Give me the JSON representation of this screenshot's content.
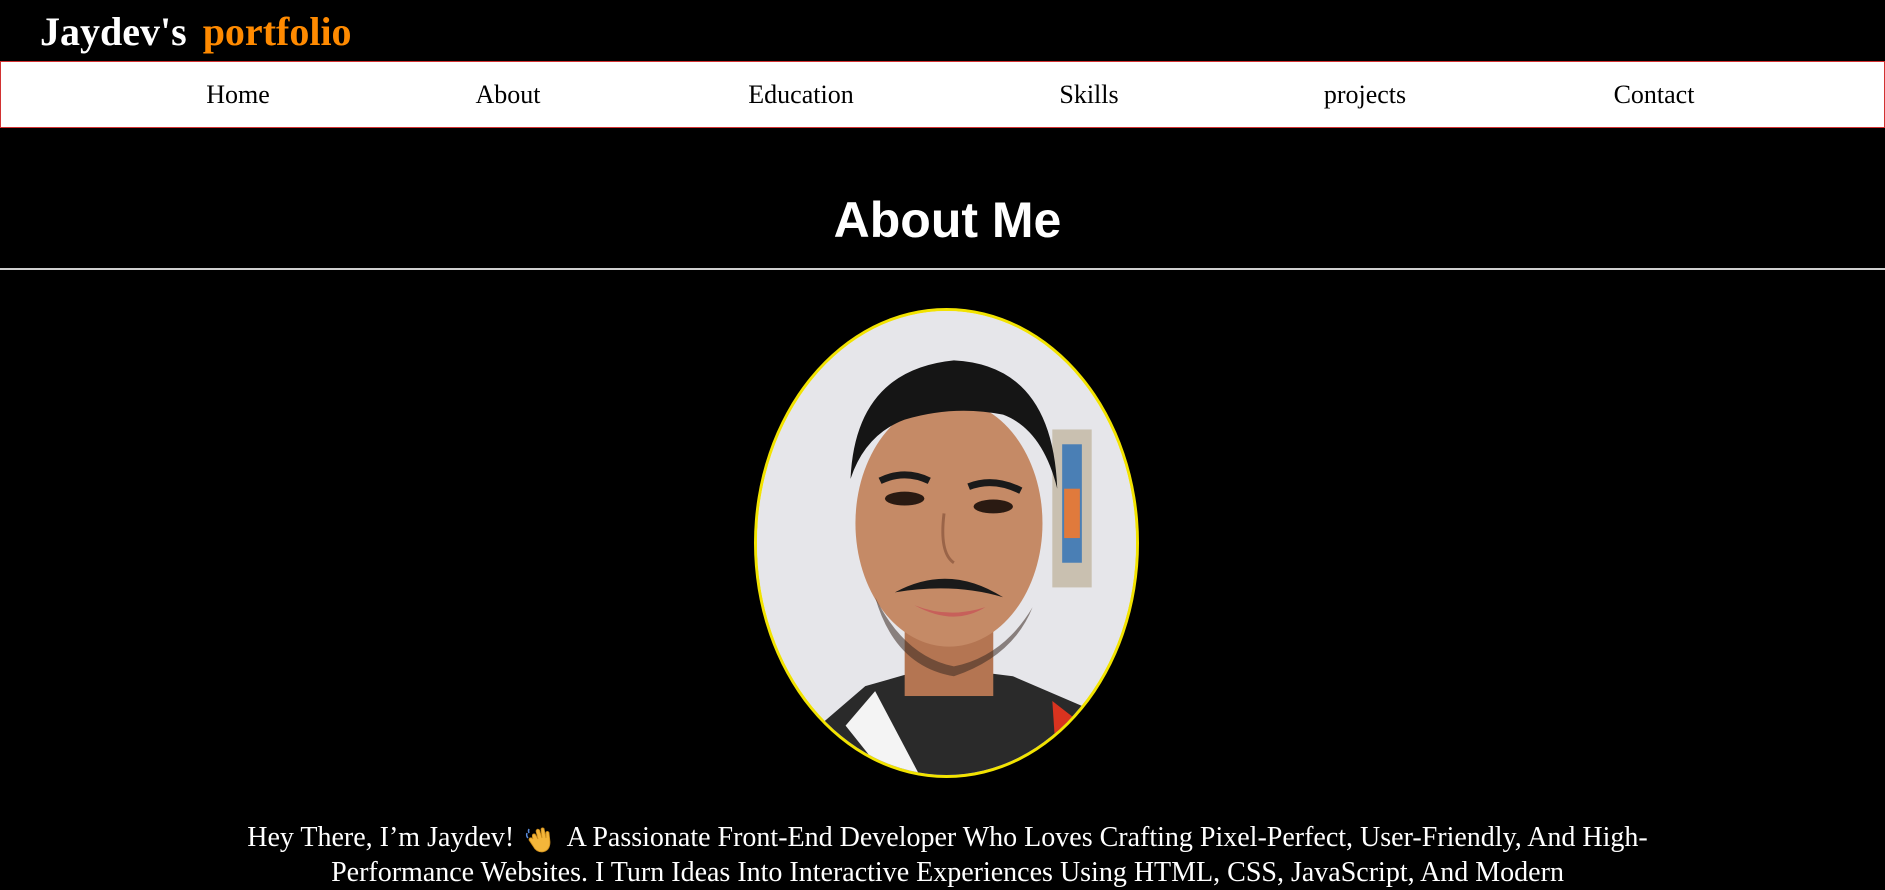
{
  "header": {
    "brand_name": "Jaydev's",
    "brand_accent": "portfolio",
    "brand_accent_color": "#ff8a00"
  },
  "nav": {
    "items": [
      {
        "label": "Home"
      },
      {
        "label": "About"
      },
      {
        "label": "Education"
      },
      {
        "label": "Skills"
      },
      {
        "label": "projects"
      },
      {
        "label": "Contact"
      }
    ]
  },
  "about": {
    "title": "About Me",
    "avatar_border_color": "#f2e300",
    "intro_before_icon": "Hey There, I’m Jaydev!",
    "intro_icon": "waving-hand-icon",
    "intro_after_icon": "A Passionate Front-End Developer Who Loves Crafting Pixel-Perfect, User-Friendly, And High-Performance Websites. I Turn Ideas Into Interactive Experiences Using HTML, CSS, JavaScript, And Modern"
  }
}
